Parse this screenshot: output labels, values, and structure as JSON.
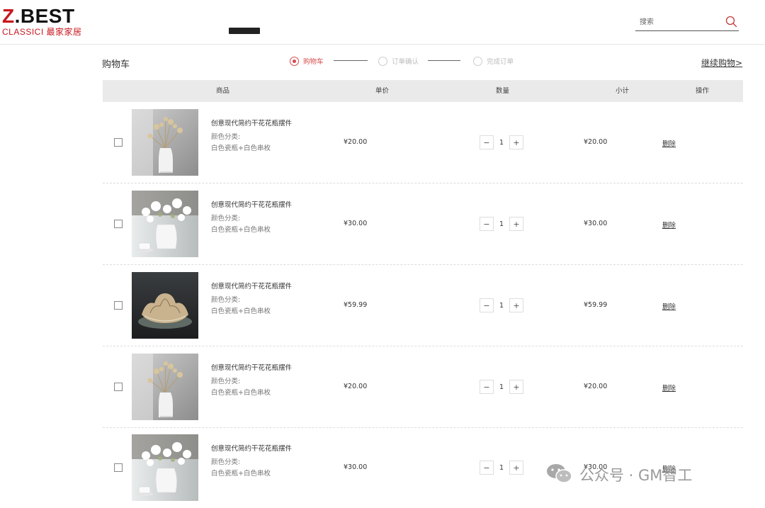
{
  "header": {
    "logo_top": "Z.BEST",
    "logo_bottom": "CLASSICI 最家家居",
    "search_placeholder": "搜索"
  },
  "page": {
    "title": "购物车",
    "continue_label": "继续购物>"
  },
  "steps": [
    {
      "label": "购物车",
      "active": true
    },
    {
      "label": "订单确认",
      "active": false
    },
    {
      "label": "完成订单",
      "active": false
    }
  ],
  "table": {
    "headers": {
      "product": "商品",
      "unit_price": "单价",
      "quantity": "数量",
      "subtotal": "小计",
      "action": "操作"
    },
    "rows": [
      {
        "name": "创意现代简约干花花瓶摆件",
        "attr_label": "颜色分类:",
        "attr_value": "白色瓷瓶+白色串枚",
        "price": "¥20.00",
        "qty": "1",
        "subtotal": "¥20.00",
        "action": "删除",
        "image": "vase-dried-flowers"
      },
      {
        "name": "创意现代简约干花花瓶摆件",
        "attr_label": "颜色分类:",
        "attr_value": "白色瓷瓶+白色串枚",
        "price": "¥30.00",
        "qty": "1",
        "subtotal": "¥30.00",
        "action": "删除",
        "image": "vase-white-flowers"
      },
      {
        "name": "创意现代简约干花花瓶摆件",
        "attr_label": "颜色分类:",
        "attr_value": "白色瓷瓶+白色串枚",
        "price": "¥59.99",
        "qty": "1",
        "subtotal": "¥59.99",
        "action": "删除",
        "image": "lotus-ceramic"
      },
      {
        "name": "创意现代简约干花花瓶摆件",
        "attr_label": "颜色分类:",
        "attr_value": "白色瓷瓶+白色串枚",
        "price": "¥20.00",
        "qty": "1",
        "subtotal": "¥20.00",
        "action": "删除",
        "image": "vase-dried-flowers"
      },
      {
        "name": "创意现代简约干花花瓶摆件",
        "attr_label": "颜色分类:",
        "attr_value": "白色瓷瓶+白色串枚",
        "price": "¥30.00",
        "qty": "1",
        "subtotal": "¥30.00",
        "action": "删除",
        "image": "vase-white-flowers"
      }
    ],
    "qty_minus": "−",
    "qty_plus": "+"
  },
  "watermark": "公众号 · GM智工",
  "colors": {
    "accent": "#d64b4b",
    "brand_red": "#c8161d",
    "header_bg": "#eaeaea"
  }
}
